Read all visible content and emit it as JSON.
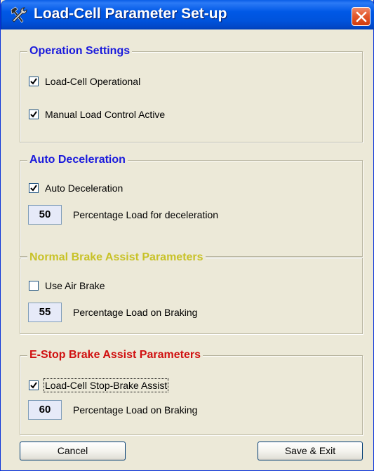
{
  "window": {
    "title": "Load-Cell Parameter Set-up",
    "icon": "tools-icon",
    "close_icon": "close-icon"
  },
  "colors": {
    "operation_title": "#1a1adc",
    "auto_decel_title": "#1a1adc",
    "normal_brake_title": "#c8c228",
    "estop_title": "#d01010"
  },
  "groups": {
    "operation": {
      "title": "Operation Settings",
      "checkboxes": [
        {
          "label": "Load-Cell Operational",
          "checked": true
        },
        {
          "label": "Manual Load Control Active",
          "checked": true
        }
      ]
    },
    "auto_decel": {
      "title": "Auto Deceleration",
      "checkbox": {
        "label": "Auto Deceleration",
        "checked": true
      },
      "value": "50",
      "value_label": "Percentage Load for deceleration"
    },
    "normal_brake": {
      "title": "Normal Brake Assist Parameters",
      "checkbox": {
        "label": "Use Air Brake",
        "checked": false
      },
      "value": "55",
      "value_label": "Percentage Load on Braking"
    },
    "estop_brake": {
      "title": "E-Stop Brake Assist Parameters",
      "checkbox": {
        "label": "Load-Cell Stop-Brake Assist",
        "checked": true
      },
      "value": "60",
      "value_label": "Percentage Load on Braking"
    }
  },
  "buttons": {
    "cancel": "Cancel",
    "save": "Save & Exit"
  }
}
